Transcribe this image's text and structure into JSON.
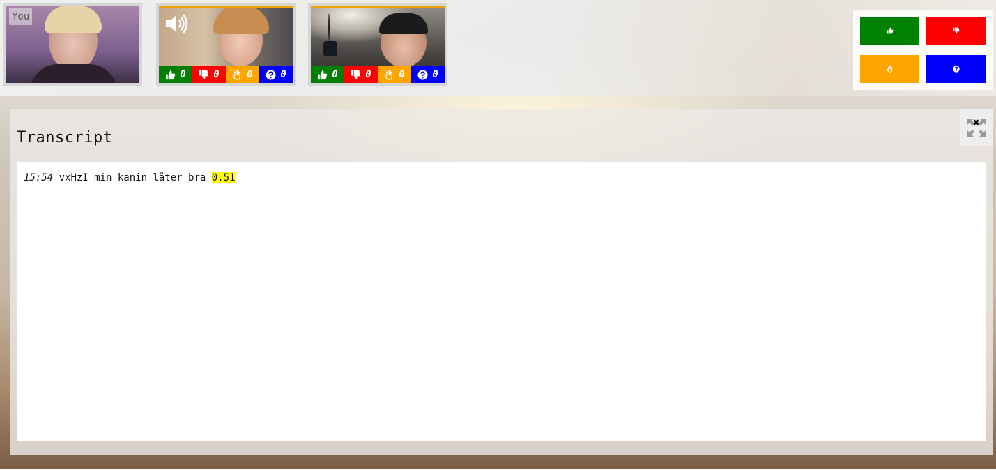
{
  "self_tile": {
    "label": "You"
  },
  "participants": [
    {
      "id": "participant-1",
      "speaking_icon": "speaker-volume-icon",
      "counters": {
        "thumbs_up": "0",
        "thumbs_down": "0",
        "raise_hand": "0",
        "question": "0"
      }
    },
    {
      "id": "participant-2",
      "counters": {
        "thumbs_up": "0",
        "thumbs_down": "0",
        "raise_hand": "0",
        "question": "0"
      }
    }
  ],
  "vote_buttons": [
    {
      "icon": "thumbs-up-icon",
      "color": "#008000"
    },
    {
      "icon": "thumbs-down-icon",
      "color": "#ff0000"
    },
    {
      "icon": "raise-hand-icon",
      "color": "#ffa500"
    },
    {
      "icon": "question-icon",
      "color": "#0000ff"
    }
  ],
  "transcript": {
    "title": "Transcript",
    "entries": [
      {
        "time": "15:54",
        "text": "vxHzI min kanin låter bra",
        "score": "0.51"
      }
    ]
  },
  "colors": {
    "speaking_border": "#f0a000",
    "score_highlight": "#ffff00"
  }
}
